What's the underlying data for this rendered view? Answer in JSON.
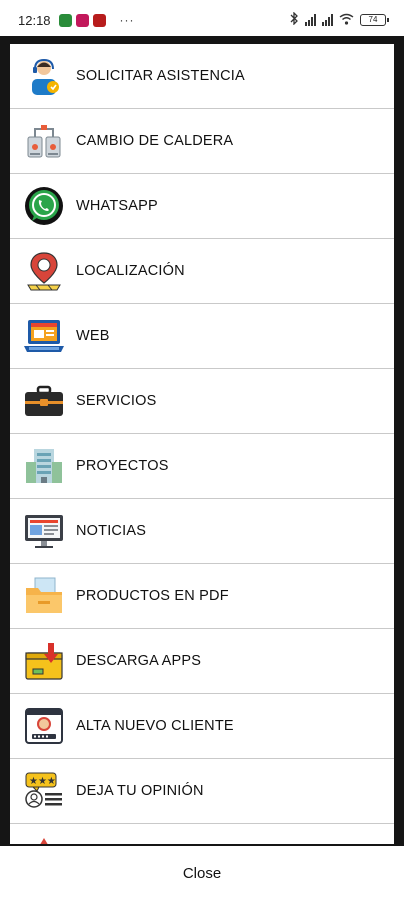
{
  "status_bar": {
    "time": "12:18",
    "dots": "···",
    "battery": "74",
    "notification_icons": [
      "whatsapp-notification-icon",
      "app-notification-icon",
      "app-notification-icon"
    ]
  },
  "menu": {
    "items": [
      {
        "label": "SOLICITAR ASISTENCIA",
        "icon": "support-agent-icon"
      },
      {
        "label": "CAMBIO DE CALDERA",
        "icon": "boiler-icon"
      },
      {
        "label": "WHATSAPP",
        "icon": "whatsapp-icon"
      },
      {
        "label": "LOCALIZACIÓN",
        "icon": "location-pin-icon"
      },
      {
        "label": "WEB",
        "icon": "laptop-web-icon"
      },
      {
        "label": "SERVICIOS",
        "icon": "briefcase-icon"
      },
      {
        "label": "PROYECTOS",
        "icon": "building-icon"
      },
      {
        "label": "NOTICIAS",
        "icon": "news-monitor-icon"
      },
      {
        "label": "PRODUCTOS EN PDF",
        "icon": "folder-icon"
      },
      {
        "label": "DESCARGA APPS",
        "icon": "download-box-icon"
      },
      {
        "label": "ALTA NUEVO CLIENTE",
        "icon": "new-client-icon"
      },
      {
        "label": "DEJA TU OPINIÓN",
        "icon": "review-rating-icon"
      }
    ]
  },
  "footer": {
    "close_label": "Close"
  },
  "colors": {
    "frame": "#151515",
    "divider": "#c9c9c9",
    "whatsapp": "#2aa54a",
    "accent_blue": "#1e5aa8"
  }
}
